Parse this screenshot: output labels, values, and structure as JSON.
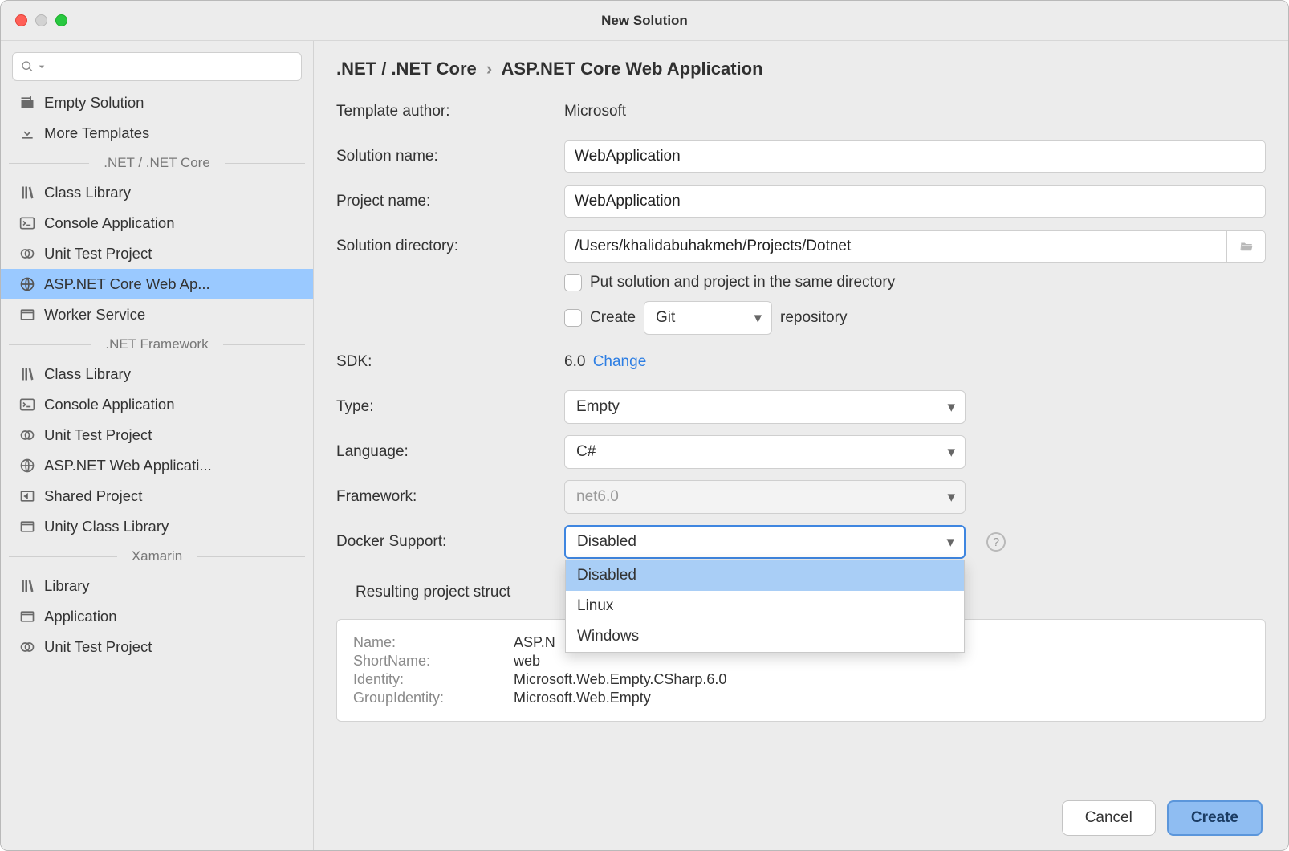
{
  "window": {
    "title": "New Solution"
  },
  "sidebar": {
    "top": [
      {
        "icon": "empty-solution",
        "label": "Empty Solution"
      },
      {
        "icon": "download",
        "label": "More Templates"
      }
    ],
    "groups": [
      {
        "title": ".NET / .NET Core",
        "items": [
          {
            "icon": "books",
            "label": "Class Library"
          },
          {
            "icon": "terminal",
            "label": "Console Application"
          },
          {
            "icon": "test",
            "label": "Unit Test Project"
          },
          {
            "icon": "globe",
            "label": "ASP.NET Core Web Ap...",
            "selected": true
          },
          {
            "icon": "window",
            "label": "Worker Service"
          }
        ]
      },
      {
        "title": ".NET Framework",
        "items": [
          {
            "icon": "books",
            "label": "Class Library"
          },
          {
            "icon": "terminal",
            "label": "Console Application"
          },
          {
            "icon": "test",
            "label": "Unit Test Project"
          },
          {
            "icon": "globe",
            "label": "ASP.NET Web Applicati..."
          },
          {
            "icon": "shared",
            "label": "Shared Project"
          },
          {
            "icon": "window",
            "label": "Unity Class Library"
          }
        ]
      },
      {
        "title": "Xamarin",
        "items": [
          {
            "icon": "books",
            "label": "Library"
          },
          {
            "icon": "window",
            "label": "Application"
          },
          {
            "icon": "test",
            "label": "Unit Test Project"
          }
        ]
      }
    ]
  },
  "breadcrumb": {
    "a": ".NET / .NET Core",
    "b": "ASP.NET Core Web Application"
  },
  "form": {
    "author_label": "Template author:",
    "author_value": "Microsoft",
    "solution_label": "Solution name:",
    "solution_value": "WebApplication",
    "project_label": "Project name:",
    "project_value": "WebApplication",
    "directory_label": "Solution directory:",
    "directory_value": "/Users/khalidabuhakmeh/Projects/Dotnet",
    "same_dir_label": "Put solution and project in the same directory",
    "create_label": "Create",
    "repo_select": "Git",
    "repo_suffix": "repository",
    "sdk_label": "SDK:",
    "sdk_value": "6.0",
    "sdk_change": "Change",
    "type_label": "Type:",
    "type_value": "Empty",
    "language_label": "Language:",
    "language_value": "C#",
    "framework_label": "Framework:",
    "framework_value": "net6.0",
    "docker_label": "Docker Support:",
    "docker_value": "Disabled",
    "docker_options": [
      "Disabled",
      "Linux",
      "Windows"
    ],
    "structure_title": "Resulting project struct",
    "preview": {
      "name_label": "Name:",
      "name_value": "ASP.N",
      "short_label": "ShortName:",
      "short_value": "web",
      "id_label": "Identity:",
      "id_value": "Microsoft.Web.Empty.CSharp.6.0",
      "gid_label": "GroupIdentity:",
      "gid_value": "Microsoft.Web.Empty"
    }
  },
  "footer": {
    "cancel": "Cancel",
    "create": "Create"
  }
}
